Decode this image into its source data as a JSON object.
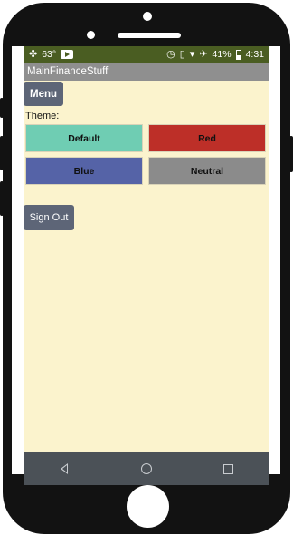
{
  "status_bar": {
    "temperature": "63°",
    "battery_percent": "41%",
    "time": "4:31",
    "icons": [
      "pinwheel-icon",
      "youtube-icon",
      "alarm-icon",
      "vibrate-icon",
      "wifi-icon",
      "airplane-icon",
      "battery-icon"
    ]
  },
  "app": {
    "title": "MainFinanceStuff"
  },
  "menu_button": {
    "label": "Menu"
  },
  "theme": {
    "label": "Theme:",
    "options": [
      {
        "label": "Default",
        "color": "#6fcdb3"
      },
      {
        "label": "Red",
        "color": "#bd2f28"
      },
      {
        "label": "Blue",
        "color": "#5563a7"
      },
      {
        "label": "Neutral",
        "color": "#8b8b8b"
      }
    ]
  },
  "sign_out_button": {
    "label": "Sign Out"
  },
  "colors": {
    "status_bar": "#4a5d22",
    "title_bar": "#8f8f8f",
    "content_background": "#fbf3cd",
    "button": "#5d6577",
    "nav_bar": "#4b5157"
  }
}
